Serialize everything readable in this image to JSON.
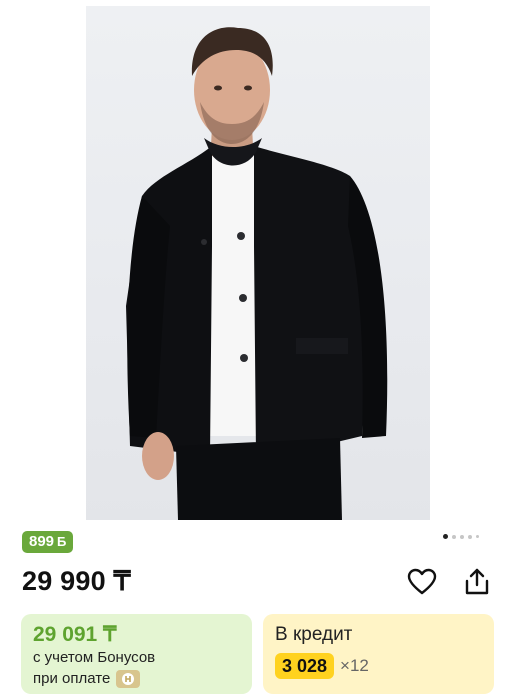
{
  "bonus_badge": {
    "amount": "899",
    "currency": "Б"
  },
  "gallery": {
    "image_alt": "Мужской черный пиджак",
    "total_slides": 5,
    "active_slide": 1
  },
  "price": {
    "value": "29 990 ₸"
  },
  "actions": {
    "favorite_icon": "heart-icon",
    "share_icon": "share-icon"
  },
  "bonus_card": {
    "price": "29 091 ₸",
    "line1": "с учетом Бонусов",
    "line2": "при оплате",
    "badge_icon": "bonus-card-icon"
  },
  "credit_card": {
    "title": "В кредит",
    "monthly": "3 028",
    "multiplier": "×12"
  },
  "colors": {
    "bonus_green": "#6aa83b",
    "bonus_card_bg": "#e4f5d2",
    "credit_card_bg": "#fff4c6",
    "credit_amount_bg": "#ffd21f"
  }
}
